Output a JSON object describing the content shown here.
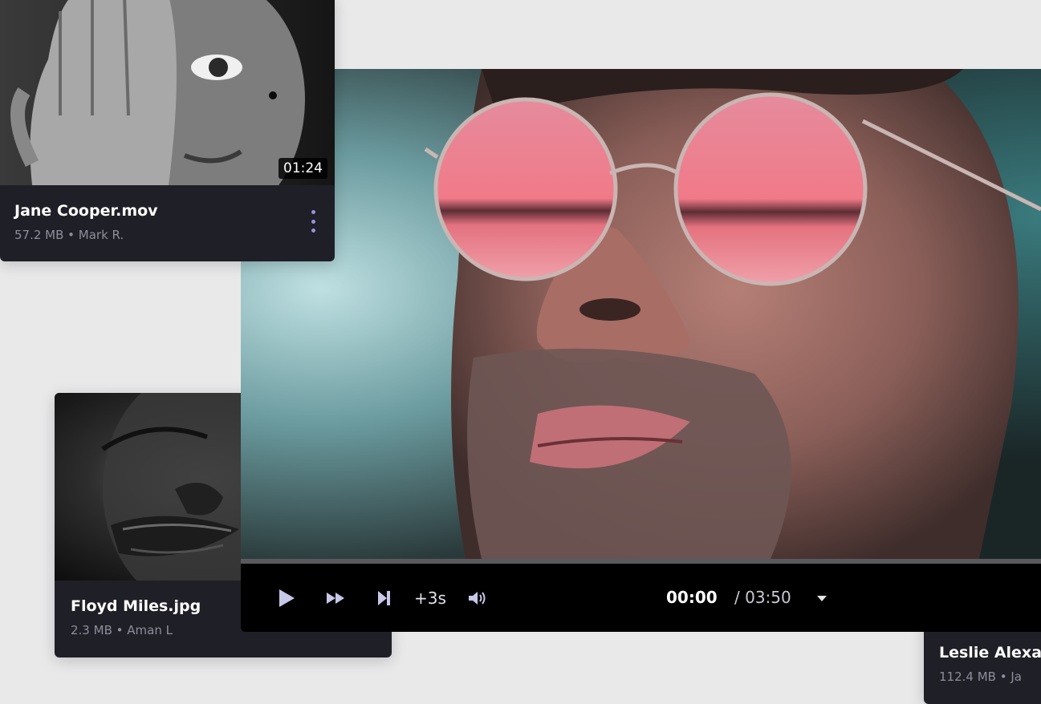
{
  "cards": {
    "jane": {
      "title": "Jane Cooper.mov",
      "size": "57.2 MB",
      "owner": "Mark R.",
      "duration": "01:24"
    },
    "floyd": {
      "title": "Floyd Miles.jpg",
      "size": "2.3 MB",
      "owner": "Aman L"
    },
    "leslie": {
      "title": "Leslie Alexan",
      "size": "112.4 MB",
      "owner": "Ja"
    }
  },
  "meta_separator": " • ",
  "player": {
    "progress": 0.0,
    "skip_label": "+3s",
    "current_time": "00:00",
    "total_time": "/ 03:50",
    "icons": [
      "play-icon",
      "fast-forward-icon",
      "skip-next-icon",
      "volume-icon",
      "chevron-down-icon"
    ]
  },
  "colors": {
    "accent": "#9a8fe0",
    "card_bg": "#1f1f27",
    "page_bg": "#e9e9ea",
    "meta": "#8e8e9c"
  }
}
